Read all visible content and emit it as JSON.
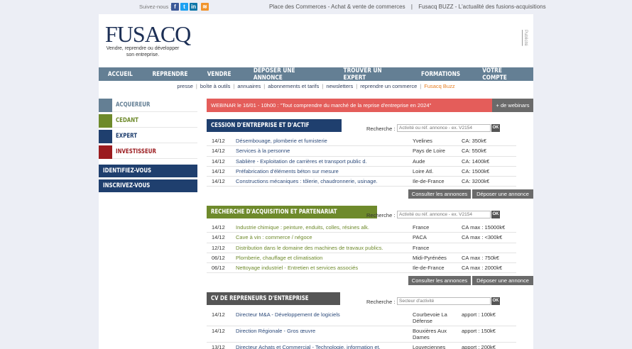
{
  "topbar": {
    "follow_label": "Suivez-nous :",
    "social": [
      {
        "icon": "facebook-icon",
        "glyph": "f",
        "color": "#3b5998"
      },
      {
        "icon": "twitter-icon",
        "glyph": "t",
        "color": "#1da1f2"
      },
      {
        "icon": "linkedin-icon",
        "glyph": "in",
        "color": "#0e76a8"
      },
      {
        "icon": "rss-icon",
        "glyph": "≋",
        "color": "#f0932b"
      }
    ],
    "link1": "Place des Commerces - Achat & vente de commerces",
    "sep": "|",
    "link2": "Fusacq BUZZ - L'actualité des fusions-acquisitions"
  },
  "header": {
    "logo": "FUSACQ",
    "tagline": "Vendre, reprendre ou développer son entreprise.",
    "publicite": "Publicité"
  },
  "nav": [
    "ACCUEIL",
    "REPRENDRE",
    "VENDRE",
    "DEPOSER UNE ANNONCE",
    "TROUVER UN EXPERT",
    "FORMATIONS",
    "VOTRE COMPTE"
  ],
  "subnav": [
    "presse",
    "boîte à outils",
    "annuaires",
    "abonnements et tarifs",
    "newsletters",
    "reprendre un commerce",
    "Fusacq Buzz"
  ],
  "subnav_sep": "|",
  "sidebar": {
    "profiles": [
      {
        "label": "ACQUEREUR",
        "color": "#647f94"
      },
      {
        "label": "CEDANT",
        "color": "#6e8a2b"
      },
      {
        "label": "EXPERT",
        "color": "#1f3f6e"
      },
      {
        "label": "INVESTISSEUR",
        "color": "#9b1b1f"
      }
    ],
    "identify": "IDENTIFIEZ-VOUS",
    "register": "INSCRIVEZ-VOUS"
  },
  "webinar": {
    "text": "WEBINAR le 16/01 - 10h00 : \"Tout comprendre du marché de la reprise d'entreprise en 2024\"",
    "button": "+ de webinars"
  },
  "search_label": "Recherche :",
  "ok_label": "OK",
  "sections": {
    "cession": {
      "title": "CESSION D'ENTREPRISE ET D'ACTIF",
      "color": "#1f3f6e",
      "placeholder": "Activité ou réf. annonce - ex. V2154",
      "rows": [
        [
          "14/12",
          "Désembouage, plomberie et fumisterie",
          "Yvelines",
          "CA: 350k€"
        ],
        [
          "14/12",
          "Services à la personne",
          "Pays de Loire",
          "CA: 550k€"
        ],
        [
          "14/12",
          "Sablière - Exploitation de carrières et transport public d.",
          "Aude",
          "CA: 1400k€"
        ],
        [
          "14/12",
          "Préfabrication d'éléments béton sur mesure",
          "Loire Atl.",
          "CA: 1500k€"
        ],
        [
          "14/12",
          "Constructions mécaniques : tôlerie, chaudronnerie, usinage.",
          "Ile-de-France",
          "CA: 3200k€"
        ]
      ],
      "btn1": "Consulter les annonces",
      "btn2": "Déposer une annonce"
    },
    "recherche": {
      "title": "RECHERCHE D'ACQUISITION ET PARTENARIAT",
      "color": "#6e8a2b",
      "placeholder": "Activité ou réf. annonce - ex. V2154",
      "rows": [
        [
          "14/12",
          "Industrie chimique : peinture, enduits, colles, résines alk.",
          "France",
          "CA max : 15000k€"
        ],
        [
          "14/12",
          "Cave à vin : commerce / négoce",
          "PACA",
          "CA max : <300k€"
        ],
        [
          "12/12",
          "Distribution dans le domaine des machines de travaux publics.",
          "France",
          ""
        ],
        [
          "06/12",
          "Plomberie, chauffage et climatisation",
          "Midi-Pyrénées",
          "CA max : 750k€"
        ],
        [
          "06/12",
          "Nettoyage industriel - Entretien et services associés",
          "Ile-de-France",
          "CA max : 2000k€"
        ]
      ],
      "btn1": "Consulter les annonces",
      "btn2": "Déposer une annonce"
    },
    "cv": {
      "title": "CV DE REPRENEURS D'ENTREPRISE",
      "color": "#555555",
      "placeholder": "Secteur d'activité",
      "rows": [
        [
          "14/12",
          "Directeur M&A - Développement de logiciels",
          "Courbevoie La Défense",
          "apport : 100k€"
        ],
        [
          "14/12",
          "Direction Régionale - Gros œuvre",
          "Bouxières Aux Dames",
          "apport : 150k€"
        ],
        [
          "13/12",
          "Directeur Achats et Commercial - Technologie, information et.",
          "Louveciennes",
          "apport : 200k€"
        ]
      ]
    }
  }
}
